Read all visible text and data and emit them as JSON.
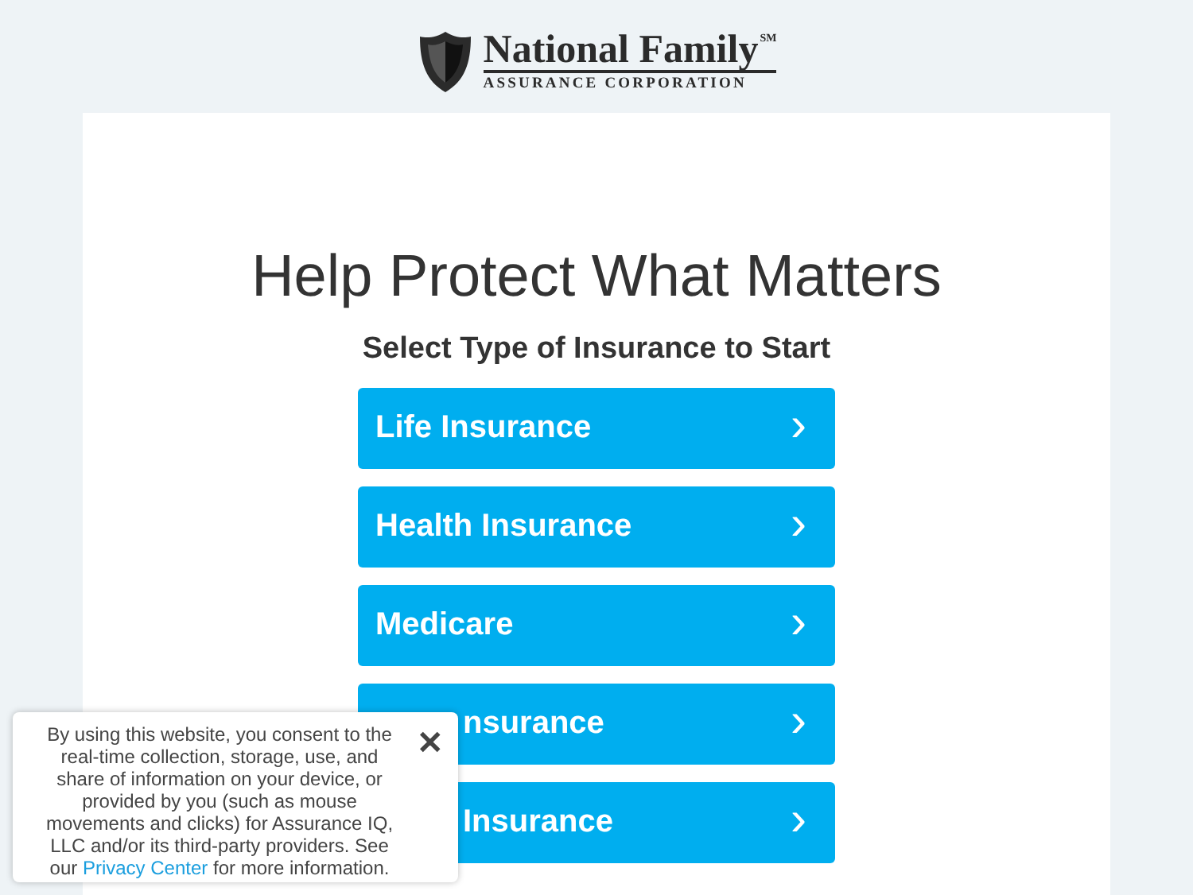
{
  "logo": {
    "name": "National Family",
    "mark": "SM",
    "tagline": "ASSURANCE CORPORATION"
  },
  "heading": "Help Protect What Matters",
  "subheading": "Select Type of Insurance to Start",
  "options": [
    {
      "label": "Life Insurance",
      "arrow": "›"
    },
    {
      "label": "Health Insurance",
      "arrow": "›"
    },
    {
      "label": "Medicare",
      "arrow": "›"
    },
    {
      "label": "nsurance",
      "partly_hidden": true,
      "arrow": "›"
    },
    {
      "label": "Insurance",
      "partly_hidden": true,
      "arrow": "›"
    }
  ],
  "consent_banner": {
    "text_before": "By using this website, you consent to the real-time collection, storage, use, and share of information on your device, or provided by you (such as mouse movements and clicks) for Assurance IQ, LLC and/or its third-party providers. See our",
    "link": "Privacy Center",
    "text_after": "for more information.",
    "close": "✕"
  }
}
